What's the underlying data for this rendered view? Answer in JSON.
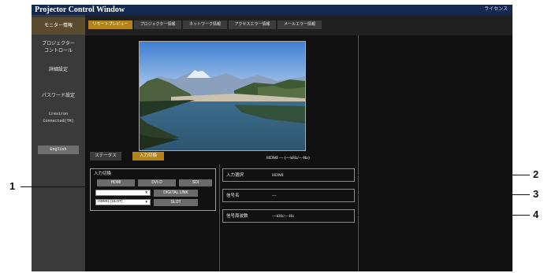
{
  "header": {
    "title": "Projector Control Window",
    "license_label": "ライセンス"
  },
  "sidebar": {
    "items": [
      {
        "label": "モニター情報",
        "active": true
      },
      {
        "label": "プロジェクター\nコントロール",
        "active": false
      },
      {
        "label": "詳細設定",
        "active": false
      },
      {
        "label": "パスワード設定",
        "active": false
      },
      {
        "label": "Crestron\nConnected(TM)",
        "active": false
      }
    ],
    "english_button": "English"
  },
  "tabs": [
    {
      "label": "リモートプレビュー",
      "active": true
    },
    {
      "label": "プロジェクター情報",
      "active": false
    },
    {
      "label": "ネットワーク情報",
      "active": false
    },
    {
      "label": "アクセスエラー情報",
      "active": false
    },
    {
      "label": "メールエラー情報",
      "active": false
    }
  ],
  "preview": {
    "subtabs": [
      {
        "label": "ステータス",
        "active": false
      },
      {
        "label": "入力切換",
        "active": true
      }
    ],
    "signal_line": "HDMI --- (---kHz/---Hz)"
  },
  "input_switch": {
    "title": "入力切換",
    "buttons": [
      "HDMI",
      "DVI-D",
      "SDI"
    ],
    "digital_link_button": "DIGITAL LINK",
    "slot_button": "SLOT",
    "select_top_value": "",
    "select_slot_value": "HDMI1 [SLOT]"
  },
  "info": {
    "rows": [
      {
        "label": "入力選択",
        "value": "HDMI"
      },
      {
        "label": "信号名",
        "value": "---"
      },
      {
        "label": "信号周波数",
        "value": "---kHz/---Hz"
      }
    ]
  },
  "callouts": [
    "1",
    "2",
    "3",
    "4"
  ],
  "colors": {
    "header": "#14294f",
    "sidebar": "#3a3a3a",
    "active_tab": "#b3841a",
    "main_bg": "#111111"
  }
}
